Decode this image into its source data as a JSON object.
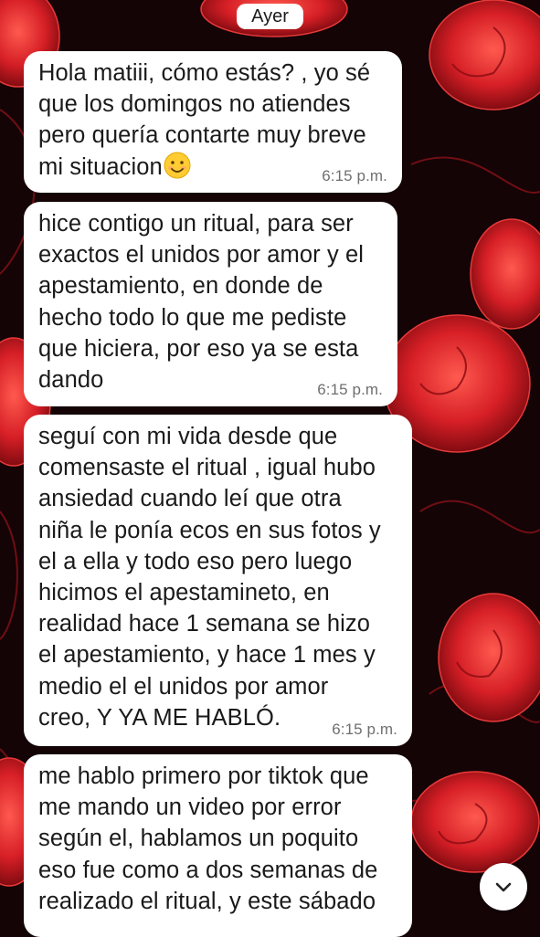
{
  "chat": {
    "date_label": "Ayer",
    "messages": [
      {
        "text": "Hola matiii, cómo estás? , yo sé\nque los domingos no atiendes\npero quería contarte muy breve\nmi situacion",
        "emoji": "smiling-face-emoji",
        "time": "6:15 p.m."
      },
      {
        "text": "hice contigo un ritual, para ser\nexactos el unidos por amor y el\napestamiento, en donde de\nhecho todo lo que me pediste\nque hiciera, por eso ya se esta\ndando",
        "time": "6:15 p.m."
      },
      {
        "text": "seguí con mi vida desde que\ncomensaste el ritual , igual hubo\nansiedad cuando leí que otra\nniña le ponía ecos en sus fotos y\nel a ella y todo eso pero luego\nhicimos el apestamineto, en\nrealidad hace 1 semana se hizo\nel apestamiento, y hace 1 mes y\nmedio el el unidos por amor\ncreo, Y YA ME HABLÓ.",
        "time": "6:15 p.m."
      },
      {
        "text": "me hablo primero por tiktok que\nme mando un video por error\nsegún el, hablamos un poquito\neso fue como a dos semanas de\nrealizado el ritual, y este sábado"
      }
    ]
  },
  "scroll_button": {
    "icon": "chevron-down-icon"
  },
  "colors": {
    "wallpaper_base": "#140406",
    "rose_red": "#d61f26",
    "rose_dark": "#8e0d14",
    "bubble": "#ffffff",
    "timestamp": "#6f6f6f"
  }
}
